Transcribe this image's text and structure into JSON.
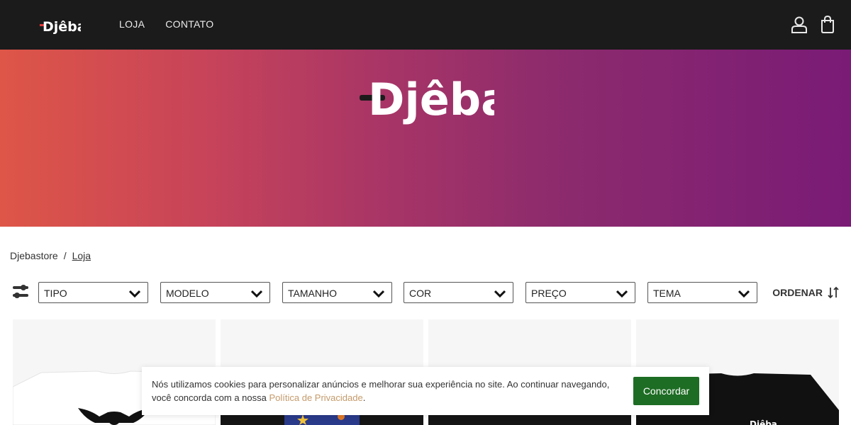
{
  "header": {
    "logo_text": "Djêba",
    "nav": [
      {
        "label": "LOJA"
      },
      {
        "label": "CONTATO"
      }
    ],
    "icons": [
      "user-icon",
      "shopping-bag-icon"
    ]
  },
  "hero": {
    "logo_text": "Djêba",
    "gradient_colors": [
      "#de5647",
      "#a83566",
      "#7a1b76"
    ]
  },
  "breadcrumb": {
    "home": "Djebastore",
    "separator": "/",
    "current": "Loja"
  },
  "filters": {
    "icon": "filter-sliders-icon",
    "selects": [
      {
        "label": "TIPO"
      },
      {
        "label": "MODELO"
      },
      {
        "label": "TAMANHO"
      },
      {
        "label": "COR"
      },
      {
        "label": "PREÇO"
      },
      {
        "label": "TEMA"
      }
    ],
    "sort_label": "ORDENAR",
    "sort_icon": "sort-arrows-icon"
  },
  "products": [
    {
      "image": "white-tshirt-winged-emblem"
    },
    {
      "image": "black-tshirt-space-print"
    },
    {
      "image": "black-tshirt"
    },
    {
      "image": "black-tshirt-djeba-logo"
    }
  ],
  "cookie_banner": {
    "text_before": "Nós utilizamos cookies para personalizar anúncios e melhorar sua experiência no site. Ao continuar navegando, você concorda com a nossa ",
    "policy_link": "Política de Privacidade",
    "text_after": ".",
    "accept_label": "Concordar",
    "accept_color": "#1d6d24"
  }
}
